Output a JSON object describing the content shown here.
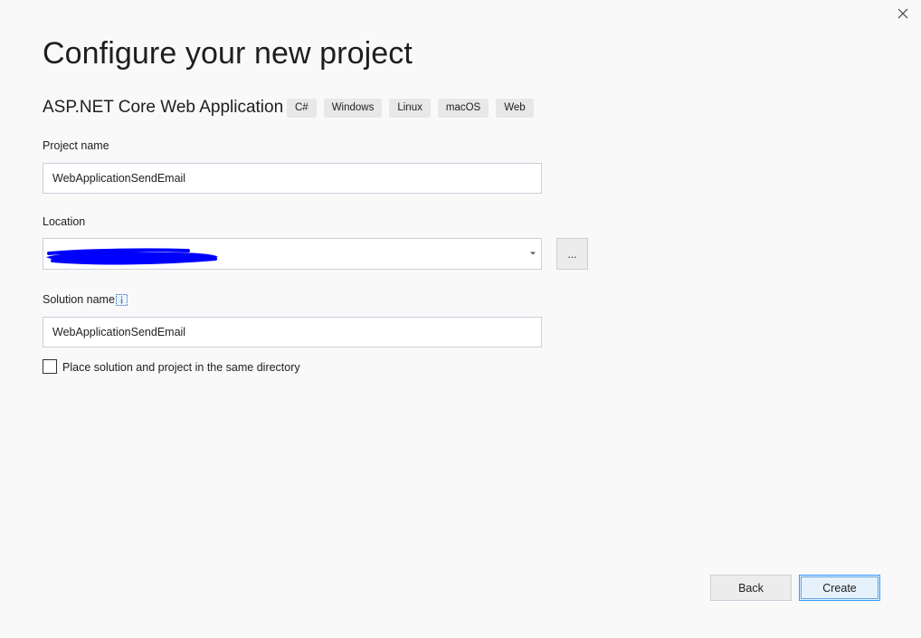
{
  "dialog": {
    "title": "Configure your new project",
    "close_icon": "close-icon"
  },
  "template": {
    "name": "ASP.NET Core Web Application",
    "tags": [
      "C#",
      "Windows",
      "Linux",
      "macOS",
      "Web"
    ]
  },
  "form": {
    "project_name": {
      "label": "Project name",
      "value": "WebApplicationSendEmail"
    },
    "location": {
      "label": "Location",
      "value": "",
      "redacted": true,
      "dropdown_icon": "chevron-down-icon",
      "browse_label": "..."
    },
    "solution_name": {
      "label": "Solution name",
      "info_icon": "info-icon",
      "value": "WebApplicationSendEmail"
    },
    "same_directory": {
      "label": "Place solution and project in the same directory",
      "checked": false
    }
  },
  "footer": {
    "back_label": "Back",
    "create_label": "Create"
  },
  "colors": {
    "background": "#f9f9f9",
    "accent": "#3399ff",
    "redaction": "#0000ff",
    "tag_background": "#e8e8e8"
  }
}
